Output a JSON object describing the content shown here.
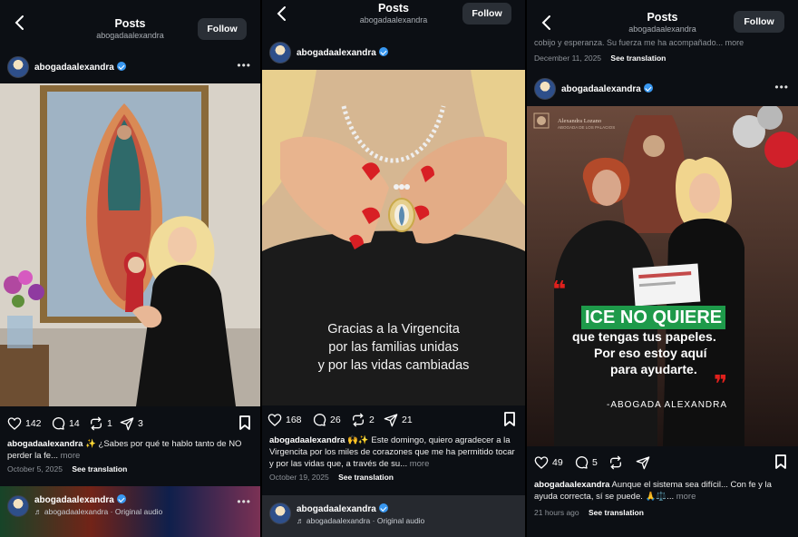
{
  "panels": [
    {
      "header": {
        "title": "Posts",
        "handle": "abogadaalexandra",
        "follow": "Follow"
      },
      "post": {
        "username": "abogadaalexandra",
        "likes": "142",
        "comments": "14",
        "reposts": "1",
        "shares": "3",
        "caption_user": "abogadaalexandra",
        "caption": "✨ ¿Sabes por qué te hablo tanto de NO perder la fe...",
        "more": "more",
        "date": "October 5, 2025",
        "see_translation": "See translation"
      },
      "next": {
        "username": "abogadaalexandra",
        "audio": "♬ abogadaalexandra · Original audio"
      }
    },
    {
      "header": {
        "title": "Posts",
        "handle": "abogadaalexandra",
        "follow": "Follow"
      },
      "post": {
        "username": "abogadaalexandra",
        "overlay_line1": "Gracias a la Virgencita",
        "overlay_line2": "por las familias unidas",
        "overlay_line3": "y por las vidas cambiadas",
        "likes": "168",
        "comments": "26",
        "reposts": "2",
        "shares": "21",
        "caption_user": "abogadaalexandra",
        "caption": "🙌✨ Este domingo, quiero agradecer a la Virgencita por los miles de corazones que me ha permitido tocar y por las vidas que, a través de su...",
        "more": "more",
        "date": "October 19, 2025",
        "see_translation": "See translation"
      },
      "next": {
        "username": "abogadaalexandra",
        "audio": "♬ abogadaalexandra · Original audio"
      }
    },
    {
      "header": {
        "title": "Posts",
        "handle": "abogadaalexandra",
        "follow": "Follow"
      },
      "prev": {
        "caption": "cobijo y esperanza. Su fuerza me ha acompañado...",
        "more": "more",
        "date": "December 11, 2025",
        "see_translation": "See translation"
      },
      "post": {
        "username": "abogadaalexandra",
        "logo_name": "Alexandra Lozano",
        "logo_sub": "ABOGADA DE LOS PALACIOS",
        "headline": "ICE NO QUIERE",
        "line1": "que tengas tus papeles.",
        "line2": "Por eso estoy aquí",
        "line3": "para ayudarte.",
        "signature": "-ABOGADA ALEXANDRA",
        "likes": "49",
        "comments": "5",
        "caption_user": "abogadaalexandra",
        "caption": "Aunque el sistema sea difícil... Con fe y la ayuda correcta, sí se puede. 🙏⚖️...",
        "more": "more",
        "date": "21 hours ago",
        "see_translation": "See translation"
      }
    }
  ],
  "colors": {
    "bg": "#0c0f14",
    "button": "#2a2f36",
    "verified": "#3897f0",
    "headline_bg": "#1e9a4a",
    "quote_red": "#e0201c"
  }
}
